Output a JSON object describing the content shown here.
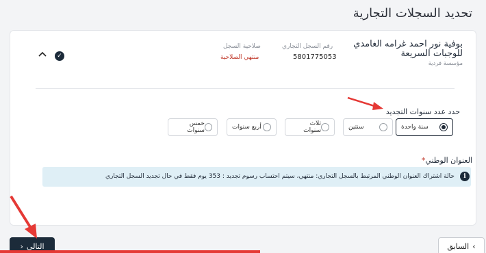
{
  "page": {
    "title": "تحديد السجلات التجارية"
  },
  "record": {
    "name": "بوفية نور احمد غرامه الغامدي للوجبات السريعة",
    "type": "مؤسسة فردية",
    "cr_label": "رقم السجل التجاري",
    "cr_value": "5801775053",
    "validity_label": "صلاحية السجل",
    "validity_value": "منتهي الصلاحية"
  },
  "renewal": {
    "label": "حدد عدد سنوات التجديد",
    "options": [
      {
        "label": "سنة واحدة",
        "selected": true
      },
      {
        "label": "سنتين",
        "selected": false
      },
      {
        "label": "ثلاث سنوات",
        "selected": false
      },
      {
        "label": "أربع سنوات",
        "selected": false
      },
      {
        "label": "خمس سنوات",
        "selected": false
      }
    ]
  },
  "address": {
    "label": "العنوان الوطني",
    "required_mark": "*",
    "info": "حالة اشتراك العنوان الوطني المرتبط بالسجل التجاري: منتهي، سيتم احتساب رسوم تجديد : 353 يوم فقط في حال تجديد السجل التجاري"
  },
  "nav": {
    "next_label": "التالي",
    "prev_label": "السابق"
  },
  "colors": {
    "primary": "#1c2b3a",
    "expired": "#c0392b",
    "info_bg": "#dfeff6",
    "annotation": "#e53935"
  }
}
